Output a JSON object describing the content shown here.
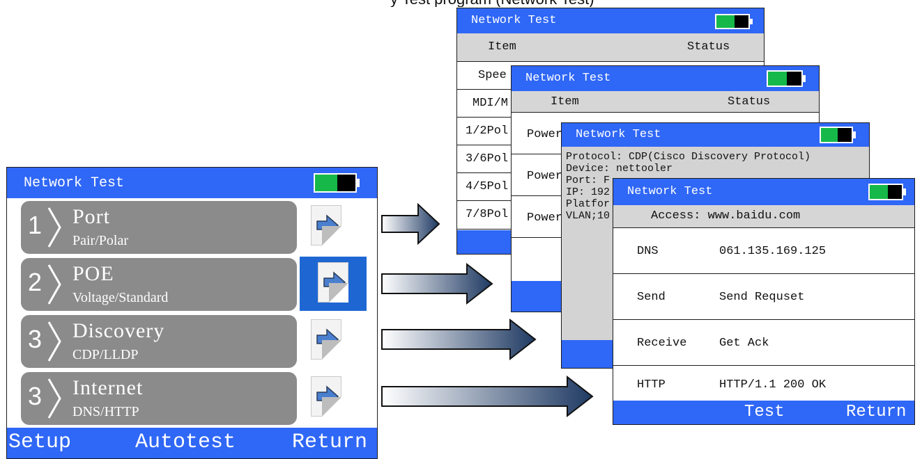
{
  "caption": "y Test program (Network Test)",
  "main": {
    "title": "Network Test",
    "items": [
      {
        "num": "1",
        "title": "Port",
        "sub": "Pair/Polar"
      },
      {
        "num": "2",
        "title": "POE",
        "sub": "Voltage/Standard"
      },
      {
        "num": "3",
        "title": "Discovery",
        "sub": "CDP/LLDP"
      },
      {
        "num": "3",
        "title": "Internet",
        "sub": "DNS/HTTP"
      }
    ],
    "footer": {
      "setup": "Setup",
      "autotest": "Autotest",
      "return": "Return"
    }
  },
  "port_win": {
    "title": "Network Test",
    "col_item": "Item",
    "col_status": "Status",
    "rows": [
      "Spee",
      "MDI/M",
      "1/2Pol",
      "3/6Pol",
      "4/5Pol",
      "7/8Pol"
    ]
  },
  "poe_win": {
    "title": "Network Test",
    "col_item": "Item",
    "col_status": "Status",
    "rows": [
      "Power",
      "Power",
      "Power"
    ]
  },
  "disc_win": {
    "title": "Network Test",
    "lines": [
      "Protocol: CDP(Cisco Discovery Protocol)",
      "Device: nettooler",
      "Port: F",
      "IP: 192",
      "Platfor",
      "VLAN;10"
    ]
  },
  "inet_win": {
    "title": "Network Test",
    "access": "Access: www.baidu.com",
    "rows": [
      {
        "label": "DNS",
        "value": "061.135.169.125"
      },
      {
        "label": "Send",
        "value": "Send Requset"
      },
      {
        "label": "Receive",
        "value": "Get Ack"
      },
      {
        "label": "HTTP",
        "value": "HTTP/1.1 200 OK"
      }
    ],
    "footer": {
      "test": "Test",
      "return": "Return"
    }
  },
  "colors": {
    "titlebar": "#2f67f6",
    "menu_item": "#8b8b8b",
    "selected": "#1e67d3",
    "battery_green": "#16b84a",
    "header_gray": "#d6d6d6"
  },
  "icons": [
    "battery-icon",
    "arrow-right-icon",
    "flow-arrow-icon"
  ]
}
